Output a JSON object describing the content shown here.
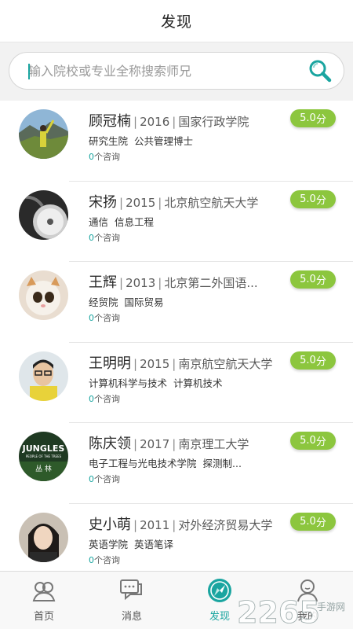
{
  "header": {
    "title": "发现"
  },
  "search": {
    "placeholder": "输入院校或专业全称搜索师兄"
  },
  "consult_suffix": "个咨询",
  "rating_suffix": "分",
  "mentors": [
    {
      "name": "顾冠楠",
      "year": "2016",
      "school": "国家行政学院",
      "dept": "研究生院",
      "major": "公共管理博士",
      "consults": "0",
      "rating": "5.0"
    },
    {
      "name": "宋扬",
      "year": "2015",
      "school": "北京航空航天大学",
      "dept": "通信",
      "major": "信息工程",
      "consults": "0",
      "rating": "5.0"
    },
    {
      "name": "王辉",
      "year": "2013",
      "school": "北京第二外国语...",
      "dept": "经贸院",
      "major": "国际贸易",
      "consults": "0",
      "rating": "5.0"
    },
    {
      "name": "王明明",
      "year": "2015",
      "school": "南京航空航天大学",
      "dept": "计算机科学与技术",
      "major": "计算机技术",
      "consults": "0",
      "rating": "5.0"
    },
    {
      "name": "陈庆领",
      "year": "2017",
      "school": "南京理工大学",
      "dept": "电子工程与光电技术学院",
      "major": "探测制...",
      "consults": "0",
      "rating": "5.0"
    },
    {
      "name": "史小萌",
      "year": "2011",
      "school": "对外经济贸易大学",
      "dept": "英语学院",
      "major": "英语笔译",
      "consults": "0",
      "rating": "5.0"
    }
  ],
  "avatar_texts": {
    "jungles": "JUNGLES",
    "jungles_sub": "PEOPLE OF THE TREES",
    "conglin": "丛 林"
  },
  "tabs": [
    {
      "label": "首页",
      "icon": "home-people-icon"
    },
    {
      "label": "消息",
      "icon": "message-icon"
    },
    {
      "label": "发现",
      "icon": "compass-icon",
      "active": true
    },
    {
      "label": "我的",
      "icon": "profile-icon"
    }
  ],
  "watermark": {
    "text": "2265",
    "sub": "手游网"
  },
  "colors": {
    "accent": "#1aa5a0",
    "rating_bg": "#8cc63e",
    "divider": "#e5e5e5"
  }
}
